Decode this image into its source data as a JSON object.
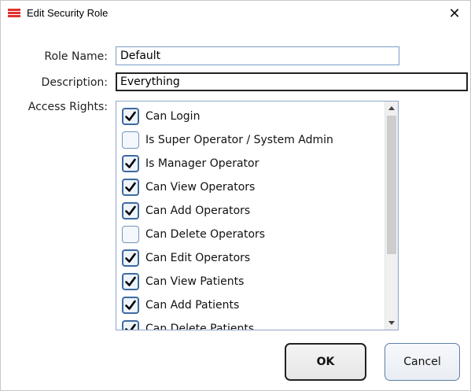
{
  "window": {
    "title": "Edit Security Role",
    "close_label": "✕"
  },
  "form": {
    "role_name_label": "Role Name:",
    "role_name_value": "Default",
    "description_label": "Description:",
    "description_value": "Everything",
    "access_rights_label": "Access Rights:"
  },
  "access_rights": [
    {
      "label": "Can Login",
      "checked": true
    },
    {
      "label": "Is Super Operator / System Admin",
      "checked": false
    },
    {
      "label": "Is Manager Operator",
      "checked": true
    },
    {
      "label": "Can View Operators",
      "checked": true
    },
    {
      "label": "Can Add Operators",
      "checked": true
    },
    {
      "label": "Can Delete Operators",
      "checked": false
    },
    {
      "label": "Can Edit Operators",
      "checked": true
    },
    {
      "label": "Can View Patients",
      "checked": true
    },
    {
      "label": "Can Add Patients",
      "checked": true
    },
    {
      "label": "Can Delete Patients",
      "checked": true
    }
  ],
  "buttons": {
    "ok_label": "OK",
    "cancel_label": "Cancel"
  },
  "colors": {
    "accent": "#3d6aa1",
    "icon_red": "#e03232"
  },
  "icons": {
    "app": "list-icon",
    "close": "close-icon",
    "check": "check-icon"
  }
}
